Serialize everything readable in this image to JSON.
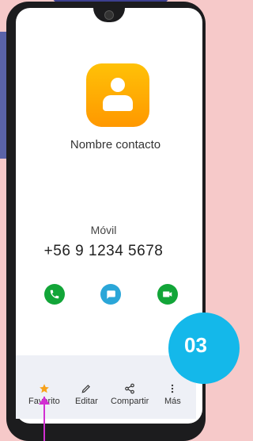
{
  "contact": {
    "name": "Nombre contacto",
    "phone_type": "Móvil",
    "phone_number": "+56 9 1234 5678"
  },
  "actions": [
    {
      "icon": "phone-icon",
      "color": "#12a538"
    },
    {
      "icon": "message-icon",
      "color": "#2aa6d8"
    },
    {
      "icon": "video-icon",
      "color": "#12a538"
    }
  ],
  "toolbar": {
    "favorite_label": "Favorito",
    "edit_label": "Editar",
    "share_label": "Compartir",
    "more_label": "Más"
  },
  "badge": {
    "text": "03"
  },
  "colors": {
    "avatar_gradient_top": "#ffc107",
    "avatar_gradient_bottom": "#ff9800",
    "badge": "#14b8ea",
    "arrow": "#d22fd2"
  }
}
